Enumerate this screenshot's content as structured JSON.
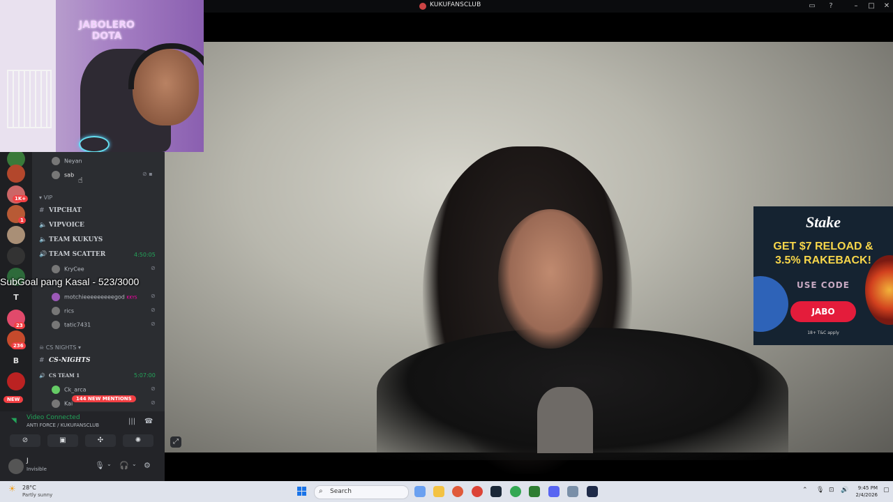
{
  "window": {
    "title": "KUKUFANSCLUB"
  },
  "webcam_overlay": {
    "logo_lines": [
      "JABOLERO",
      "DOTA"
    ]
  },
  "server_list": {
    "badges": [
      "1K+",
      "1",
      "23",
      "236"
    ],
    "letters": [
      "T",
      "B"
    ],
    "new_label": "NEW"
  },
  "channels": {
    "voice_users_top": [
      "Neyan",
      "sab"
    ],
    "vip_category": "VIP",
    "items": [
      {
        "label": "VIPCHAT",
        "kind": "text"
      },
      {
        "label": "VIPVOICE",
        "kind": "voice"
      },
      {
        "label": "TEAM KUKUYS",
        "kind": "voice"
      },
      {
        "label": "TEAM SCATTER",
        "kind": "voice",
        "timer": "4:50:05"
      }
    ],
    "scatter_users": [
      "KryCee",
      "motchieeeeeeeeegod",
      "rics",
      "tatic7431"
    ],
    "user_tag": "KKYS",
    "cs_category": "CS NIGHTS",
    "cs_nights": "CS-NIGHTS",
    "cs_team": {
      "label": "CS TEAM 1",
      "timer": "5:07:00"
    },
    "cs_users": [
      "Ck_arca",
      "Kai"
    ],
    "mentions": "144 NEW MENTIONS"
  },
  "subgoal": "SubGoal pang Kasal - 523/3000",
  "voice_panel": {
    "status": "Video Connected",
    "channel": "ANTI FORCE / KUKUFANSCLUB"
  },
  "user_panel": {
    "name": "J",
    "status": "Invisible"
  },
  "ad": {
    "brand": "Stake",
    "headline_1": "GET $7 RELOAD &",
    "headline_2": "3.5% RAKEBACK!",
    "use_code": "USE CODE",
    "code": "JABO",
    "terms": "18+ T&C apply"
  },
  "taskbar": {
    "temp": "28°C",
    "weather": "Partly sunny",
    "search_placeholder": "Search",
    "time": "9:45 PM",
    "date": "2/4/2026"
  },
  "colors": {
    "discord_bg": "#2b2d31",
    "server_bg": "#1e1f22",
    "green": "#23a55a",
    "red": "#f23f43",
    "ad_bg": "#152331",
    "ad_yellow": "#f7d64a",
    "ad_red": "#e41c3b"
  }
}
